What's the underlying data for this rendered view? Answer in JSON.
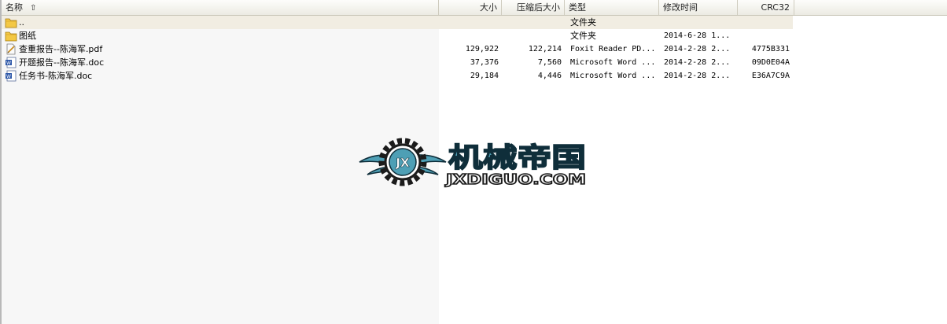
{
  "columns": {
    "name": "名称",
    "size": "大小",
    "packed": "压缩后大小",
    "type": "类型",
    "modified": "修改时间",
    "crc": "CRC32"
  },
  "sort_icon": "sort-ascending-icon",
  "rows": [
    {
      "icon": "folder-up-icon",
      "name": "..",
      "size": "",
      "packed": "",
      "type": "文件夹",
      "modified": "",
      "crc": ""
    },
    {
      "icon": "folder-icon",
      "name": "图纸",
      "size": "",
      "packed": "",
      "type": "文件夹",
      "modified": "2014-6-28 1...",
      "crc": ""
    },
    {
      "icon": "pdf-file-icon",
      "name": "查重报告--陈海军.pdf",
      "size": "129,922",
      "packed": "122,214",
      "type": "Foxit Reader PD...",
      "modified": "2014-2-28 2...",
      "crc": "4775B331"
    },
    {
      "icon": "word-doc-icon",
      "name": "开题报告--陈海军.doc",
      "size": "37,376",
      "packed": "7,560",
      "type": "Microsoft Word ...",
      "modified": "2014-2-28 2...",
      "crc": "09D0E04A"
    },
    {
      "icon": "word-doc-icon",
      "name": "任务书-陈海军.doc",
      "size": "29,184",
      "packed": "4,446",
      "type": "Microsoft Word ...",
      "modified": "2014-2-28 2...",
      "crc": "E36A7C9A"
    }
  ],
  "watermark": {
    "emblem": "JX",
    "title": "机械帝国",
    "url": "JXDIGUO.COM"
  },
  "colors": {
    "folder": "#f3c845",
    "selected_row": "#f1ede2",
    "watermark": "#4e9fb5"
  }
}
